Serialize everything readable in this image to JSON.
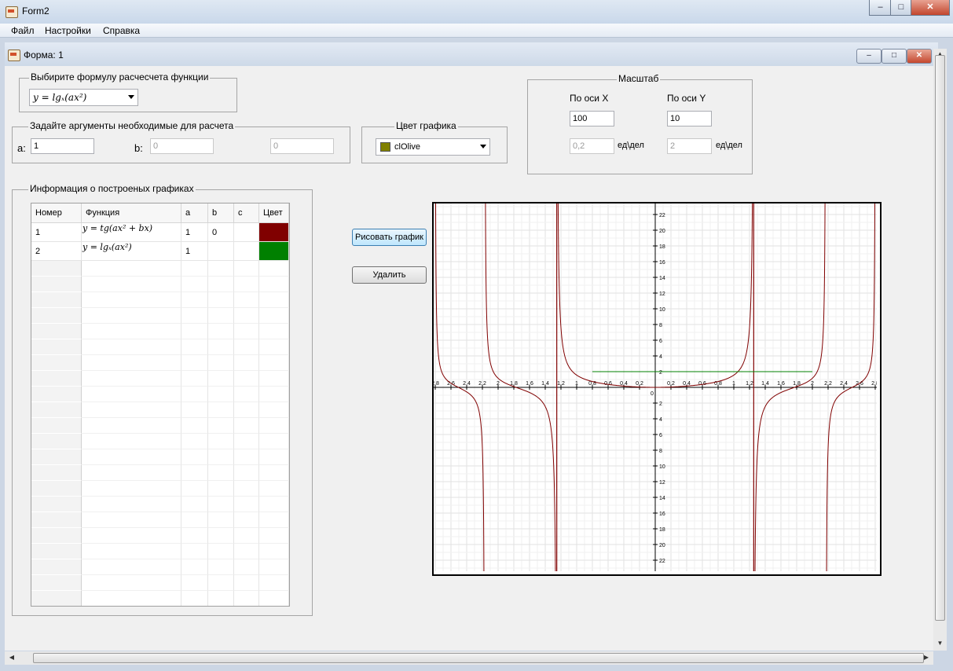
{
  "window": {
    "title": "Form2"
  },
  "menu": [
    "Файл",
    "Настройки",
    "Справка"
  ],
  "child": {
    "title": "Форма: 1"
  },
  "formula_group": {
    "legend": "Выбирите формулу расчесчета функции",
    "selected": "y = lgₓ(ax²)"
  },
  "args_group": {
    "legend": "Задайте аргументы необходимые для расчета",
    "a_label": "a:",
    "a_value": "1",
    "b_label": "b:",
    "b_value": "0",
    "c_value": "0"
  },
  "color_group": {
    "legend": "Цвет графика",
    "selected": "clOlive",
    "swatch": "#808000"
  },
  "scale_group": {
    "legend": "Масштаб",
    "x_label": "По оси X",
    "y_label": "По оси Y",
    "x_value": "100",
    "y_value": "10",
    "x_div": "0,2",
    "y_div": "2",
    "unit": "ед\\дел"
  },
  "info_group": {
    "legend": "Информация о построеных графиках",
    "columns": [
      "Номер",
      "Функция",
      "a",
      "b",
      "c",
      "Цвет"
    ],
    "rows": [
      {
        "num": "1",
        "func": "y = tg(ax² + bx)",
        "a": "1",
        "b": "0",
        "c": "",
        "color": "#800000"
      },
      {
        "num": "2",
        "func": "y = lgₓ(ax²)",
        "a": "1",
        "b": "",
        "c": "",
        "color": "#008000"
      }
    ]
  },
  "buttons": {
    "draw": "Рисовать график",
    "delete": "Удалить"
  },
  "chart_data": {
    "type": "line",
    "x_ticks": [
      "2,8",
      "2,6",
      "2,4",
      "2,2",
      "2",
      "1,8",
      "1,6",
      "1,4",
      "1,2",
      "1",
      "0,8",
      "0,6",
      "0,4",
      "0,2",
      "0,2",
      "0,4",
      "0,6",
      "0,8",
      "1",
      "1,2",
      "1,4",
      "1,6",
      "1,8",
      "2",
      "2,2",
      "2,4",
      "2,6",
      "2,8"
    ],
    "y_ticks_pos": [
      "22",
      "20",
      "18",
      "16",
      "14",
      "12",
      "10",
      "8",
      "6",
      "4",
      "2"
    ],
    "y_ticks_neg": [
      "2",
      "4",
      "6",
      "8",
      "10",
      "12",
      "14",
      "16",
      "18",
      "20",
      "22"
    ],
    "origin_label": "0",
    "xlim": [
      -2.8,
      2.8
    ],
    "ylim": [
      -23.5,
      23.5
    ],
    "series": [
      {
        "func": "tan(x^2)",
        "color": "#800000",
        "x_range": [
          -2.8,
          2.8
        ]
      },
      {
        "func": "constant",
        "value": 2,
        "color": "#008000",
        "x_range": [
          -0.8,
          2
        ]
      }
    ]
  }
}
